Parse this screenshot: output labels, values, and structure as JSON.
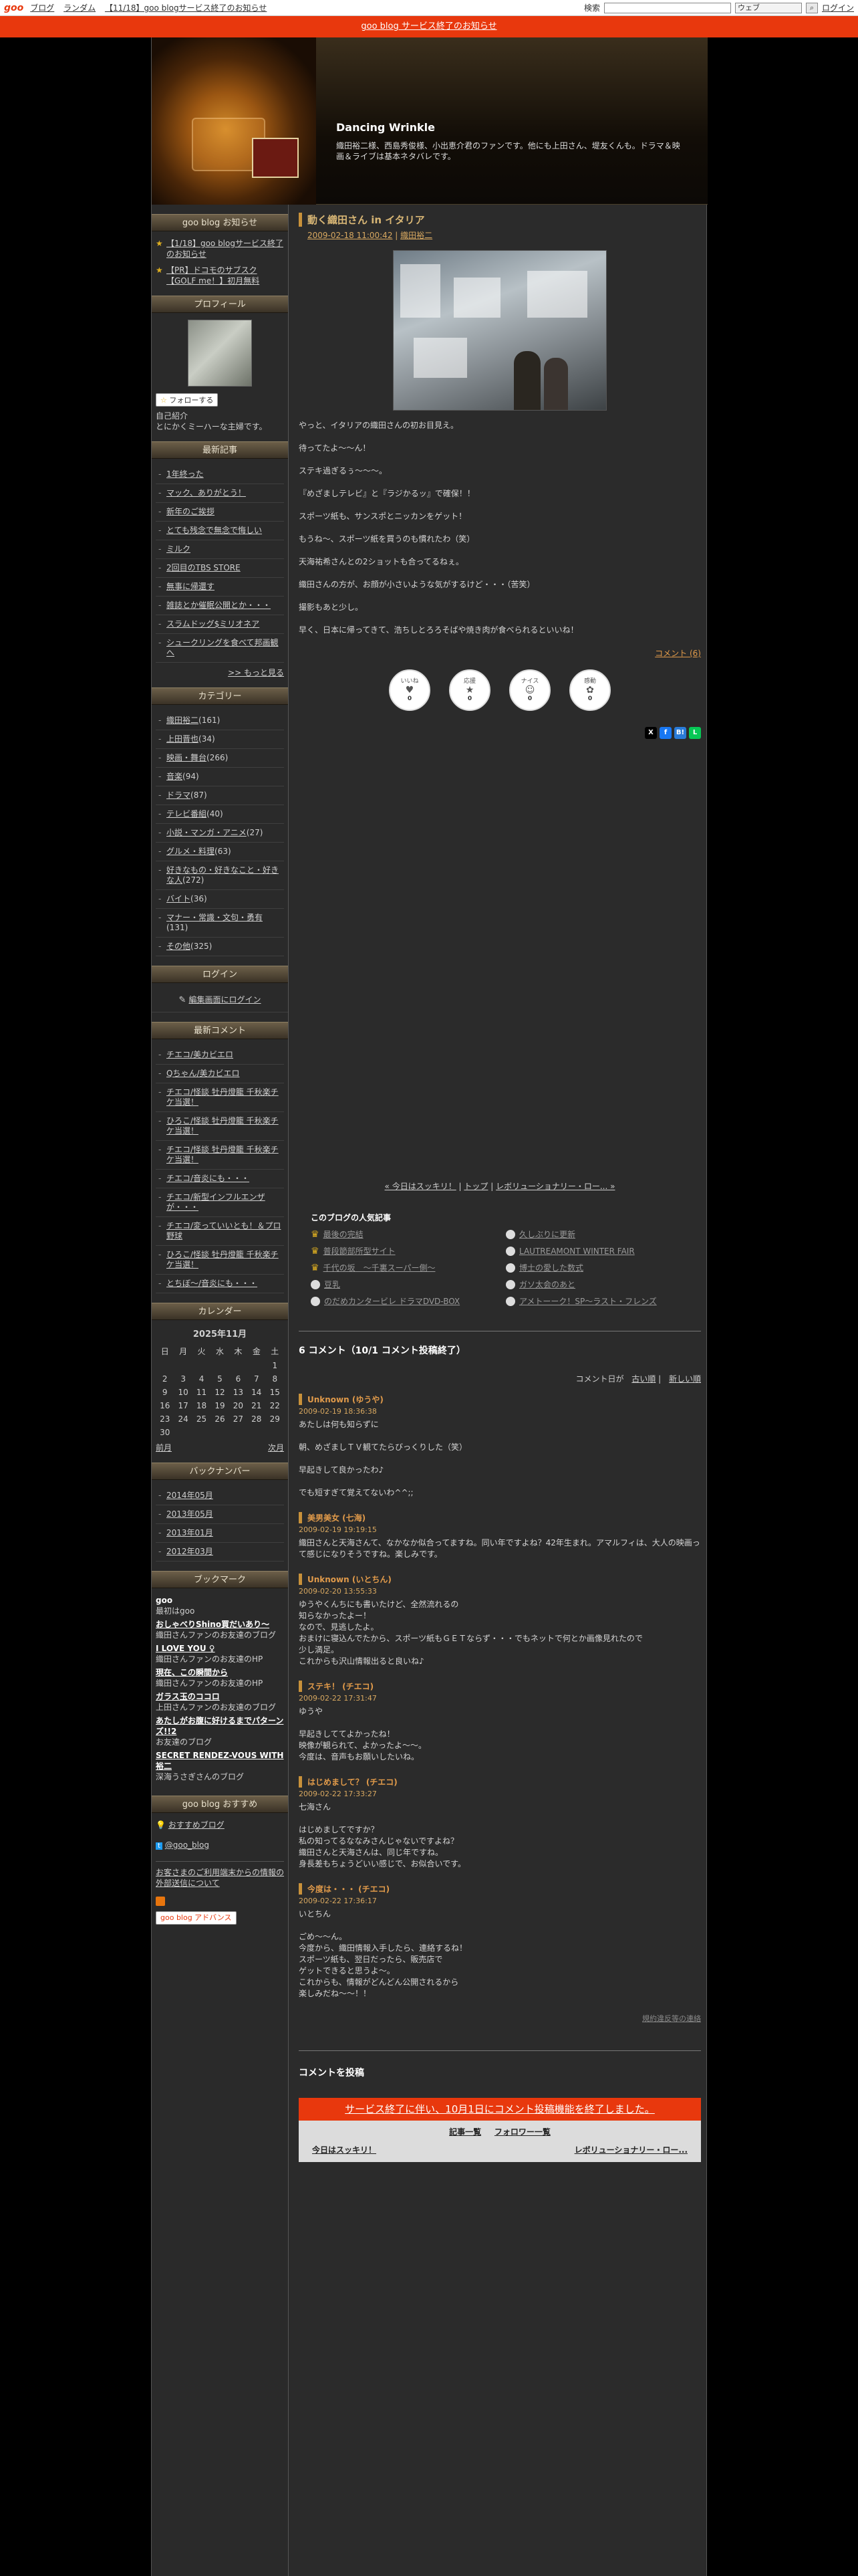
{
  "topbar": {
    "logo": "goo",
    "nav": [
      "ブログ",
      "ランダム",
      "【11/18】goo blogサービス終了のお知らせ"
    ],
    "search_label": "検索",
    "search_scope": "ウェブ",
    "login": "ログイン"
  },
  "notice": "goo blog サービス終了のお知らせ",
  "header": {
    "title": "Dancing Wrinkle",
    "description": "織田裕二様、西島秀俊様、小出恵介君のファンです。他にも上田さん、堤友くんも。ドラマ＆映画＆ライブは基本ネタバレです。"
  },
  "side": {
    "news_title": "goo blog お知らせ",
    "news": [
      "【1/18】goo blogサービス終了のお知らせ",
      "【PR】ドコモのサブスク【GOLF me！】初月無料"
    ],
    "profile_title": "プロフィール",
    "follow": "フォローする",
    "profile_text": "自己紹介\nとにかくミーハーな主婦です。",
    "recent_title": "最新記事",
    "recent": [
      "1年終った",
      "マック、ありがとう！",
      "新年のご挨拶",
      "とても残念で無念で悔しい",
      "ミルク",
      "2回目のTBS STORE",
      "無事に帰還す",
      "雑誌とか催眠公開とか・・・",
      "スラムドッグ$ミリオネア",
      "シュークリングを食べて邦画観へ"
    ],
    "recent_more": ">> もっと見る",
    "category_title": "カテゴリー",
    "categories": [
      {
        "name": "織田裕二",
        "count": "(161)"
      },
      {
        "name": "上田晋也",
        "count": "(34)"
      },
      {
        "name": "映画・舞台",
        "count": "(266)"
      },
      {
        "name": "音楽",
        "count": "(94)"
      },
      {
        "name": "ドラマ",
        "count": "(87)"
      },
      {
        "name": "テレビ番組",
        "count": "(40)"
      },
      {
        "name": "小説・マンガ・アニメ",
        "count": "(27)"
      },
      {
        "name": "グルメ・料理",
        "count": "(63)"
      },
      {
        "name": "好きなもの・好きなこと・好きな人",
        "count": "(272)"
      },
      {
        "name": "バイト",
        "count": "(36)"
      },
      {
        "name": "マナー・常識・文句・勇有",
        "count": "(131)"
      },
      {
        "name": "その他",
        "count": "(325)"
      }
    ],
    "login_title": "ログイン",
    "login_link": "編集画面にログイン",
    "comments_title": "最新コメント",
    "comments": [
      "チエコ/美カビエロ",
      "Qちゃん/美カビエロ",
      "チエコ/怪談 牡丹燈籠 千秋楽チケ当選！",
      "ひろこ/怪談 牡丹燈籠 千秋楽チケ当選！",
      "チエコ/怪談 牡丹燈籠 千秋楽チケ当選！",
      "チエコ/音炎にも・・・",
      "チエコ/新型インフルエンザが・・・",
      "チエコ/変っていいとも！＆プロ野球",
      "ひろこ/怪談 牡丹燈籠 千秋楽チケ当選！",
      "とちぼ〜/音炎にも・・・"
    ],
    "calendar_title": "カレンダー",
    "calendar": {
      "month": "2025年11月",
      "weekdays": [
        "日",
        "月",
        "火",
        "水",
        "木",
        "金",
        "土"
      ],
      "rows": [
        [
          "",
          "",
          "",
          "",
          "",
          "",
          "1"
        ],
        [
          "2",
          "3",
          "4",
          "5",
          "6",
          "7",
          "8"
        ],
        [
          "9",
          "10",
          "11",
          "12",
          "13",
          "14",
          "15"
        ],
        [
          "16",
          "17",
          "18",
          "19",
          "20",
          "21",
          "22"
        ],
        [
          "23",
          "24",
          "25",
          "26",
          "27",
          "28",
          "29"
        ],
        [
          "30",
          "",
          "",
          "",
          "",
          "",
          ""
        ]
      ],
      "prev": "前月",
      "next": "次月"
    },
    "backnumber_title": "バックナンバー",
    "backnumbers": [
      "2014年05月",
      "2013年05月",
      "2013年01月",
      "2012年03月"
    ],
    "bookmark_title": "ブックマーク",
    "bookmarks": [
      {
        "name": "goo",
        "desc": "最初はgoo"
      },
      {
        "name": "おしゃべりShino買だいあり〜",
        "desc": "織田さんファンのお友達のブログ"
      },
      {
        "name": "I LOVE YOU ♀",
        "desc": "織田さんファンのお友達のHP"
      },
      {
        "name": "現在、この瞬間から",
        "desc": "織田さんファンのお友達のHP"
      },
      {
        "name": "ガラス玉のココロ",
        "desc": "上田さんファンのお友達のブログ"
      },
      {
        "name": "あたしがお腹に好けるまでパターンズ!!2",
        "desc": "お友達のブログ"
      },
      {
        "name": "SECRET RENDEZ-VOUS WITH 裕二",
        "desc": "深海うさぎさんのブログ"
      }
    ],
    "recommend_title": "goo blog おすすめ",
    "recommend": [
      "おすすめブログ",
      "@goo_blog",
      "お客さまのご利用端末からの情報の外部送信について"
    ],
    "adv": "goo blog アドバンス"
  },
  "post": {
    "title": "動く織田さん in イタリア",
    "date": "2009-02-18 11:00:42",
    "category": "織田裕二",
    "paragraphs": [
      "やっと、イタリアの織田さんの初お目見え。",
      "待ってたよ〜〜ん！",
      "ステキ過ぎるぅ〜〜〜。",
      "『めざましテレビ』と『ラジかるッ』で確保！！",
      "スポーツ紙も、サンスポとニッカンをゲット！",
      "もうね〜、スポーツ紙を買うのも慣れたわ（笑）",
      "天海祐希さんとの2ショットも合ってるねぇ。",
      "織田さんの方が、お顔が小さいような気がするけど・・・（苦笑）",
      "撮影もあと少し。",
      "早く、日本に帰ってきて、浩ちしとろろそばや焼き肉が食べられるといいね！"
    ],
    "comment_link": "コメント (6)",
    "reactions": [
      {
        "label": "いいね",
        "count": "0",
        "emoji": "♥"
      },
      {
        "label": "応援",
        "count": "0",
        "emoji": "★"
      },
      {
        "label": "ナイス",
        "count": "0",
        "emoji": "☺"
      },
      {
        "label": "感動",
        "count": "0",
        "emoji": "✿"
      }
    ],
    "share": [
      "X",
      "f",
      "B!",
      "L"
    ]
  },
  "pager": {
    "prev": "« 今日はスッキリ！",
    "top": "トップ",
    "next": "レボリューショナリー・ロー... »"
  },
  "popular": {
    "title": "このブログの人気記事",
    "items": [
      "最後の完結",
      "久しぶりに更新",
      "普段節部所型サイト",
      "LAUTREAMONT WINTER FAIR",
      "千代の坂　〜千裏スーパー側〜",
      "博士の愛した数式",
      "豆乳",
      "ガソ太会のあと",
      "のだめカンタービレ ドラマDVD-BOX",
      "アメトーーク！SP〜ラスト・フレンズ"
    ]
  },
  "comments": {
    "heading": "6 コメント（10/1 コメント投稿終了）",
    "sort_label": "コメント日が",
    "sort_old": "古い順",
    "sort_new": "新しい順",
    "items": [
      {
        "name": "Unknown (ゆうや)",
        "date": "2009-02-19 18:36:38",
        "lines": [
          "あたしは何も知らずに",
          "",
          "朝、めざましＴＶ観てたらびっくりした（笑）",
          "",
          "早起きして良かったわ♪",
          "",
          "でも短すぎて覚えてないわ^^;;"
        ]
      },
      {
        "name": "美男美女 (七海)",
        "date": "2009-02-19 19:19:15",
        "lines": [
          "織田さんと天海さんて、なかなか似合ってますね。同い年ですよね？42年生まれ。アマルフィは、大人の映画って感じになりそうですね。楽しみです。"
        ]
      },
      {
        "name": "Unknown (いとちん)",
        "date": "2009-02-20 13:55:33",
        "lines": [
          "ゆうやくんちにも書いたけど、全然流れるの",
          "知らなかったよー！",
          "なので、見逃したよ。",
          "おまけに寝込んでたから、スポーツ紙もＧＥＴならず・・・でもネットで何とか画像見れたので",
          "少し満足。",
          "これからも沢山情報出ると良いね♪"
        ]
      },
      {
        "name": "ステキ！ (チエコ)",
        "date": "2009-02-22 17:31:47",
        "lines": [
          "ゆうや",
          "",
          "早起きしててよかったね！",
          "映像が観られて、よかったよ〜〜。",
          "今度は、音声もお願いしたいね。"
        ]
      },
      {
        "name": "はじめまして？ (チエコ)",
        "date": "2009-02-22 17:33:27",
        "lines": [
          "七海さん",
          "",
          "はじめましてですか？",
          "私の知ってるななみさんじゃないですよね？",
          "織田さんと天海さんは、同じ年ですね。",
          "身長差もちょうどいい感じで、お似合いです。"
        ]
      },
      {
        "name": "今度は・・・ (チエコ)",
        "date": "2009-02-22 17:36:17",
        "lines": [
          "いとちん",
          "",
          "ごめ〜〜ん。",
          "今度から、織田情報入手したら、連絡するね！",
          "スポーツ紙も、翌日だったら、販売店で",
          "ゲットできると思うよ〜。",
          "これからも、情報がどんどん公開されるから",
          "楽しみだね〜〜！！"
        ]
      }
    ],
    "report": "規約違反等の連絡",
    "post_heading": "コメントを投稿",
    "closed": "サービス終了に伴い、10月1日にコメント投稿機能を終了しました。",
    "footer_links": [
      "記事一覧",
      "フォロワー一覧"
    ],
    "footer_prev": "今日はスッキリ！",
    "footer_next": "レボリューショナリー・ロー..."
  }
}
